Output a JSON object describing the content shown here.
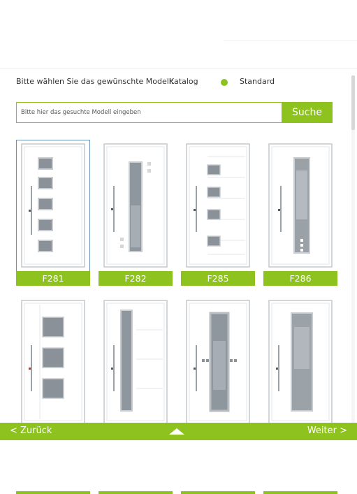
{
  "selector": {
    "prompt": "Bitte wählen Sie das gewünschte Modell:",
    "option_catalog": "Katalog",
    "option_standard": "Standard"
  },
  "search": {
    "placeholder": "Bitte hier das gesuchte Modell eingeben",
    "button_label": "Suche"
  },
  "models": [
    {
      "label": "F281",
      "selected": true
    },
    {
      "label": "F282",
      "selected": false
    },
    {
      "label": "F285",
      "selected": false
    },
    {
      "label": "F286",
      "selected": false
    },
    {
      "label": "",
      "selected": false
    },
    {
      "label": "",
      "selected": false
    },
    {
      "label": "",
      "selected": false
    },
    {
      "label": "",
      "selected": false
    }
  ],
  "navigation": {
    "back_label": "< Zurück",
    "next_label": "Weiter >"
  },
  "colors": {
    "accent": "#8dc21f",
    "selected_border": "#6a8fb8"
  }
}
